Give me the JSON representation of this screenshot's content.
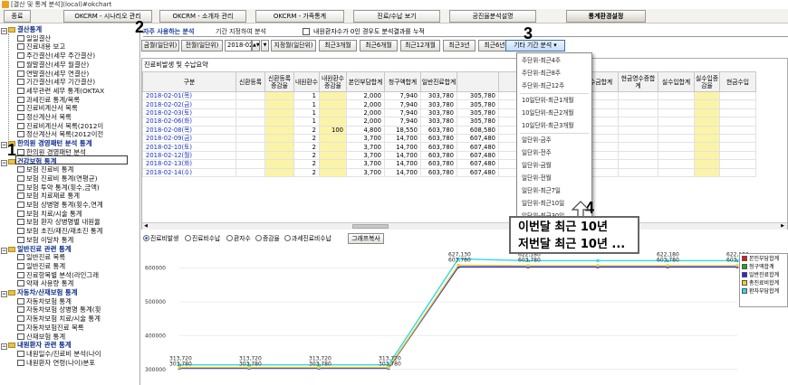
{
  "window_title": "[결산 및 통계 분석](local)#okchart",
  "top_menu": {
    "items": [
      "종료",
      "OKCRM - 시나리오 관리",
      "OKCRM - 소개자 관리",
      "OKCRM - 가족통계",
      "진료/수납 보기",
      "공진율분석설명",
      "통계환경설정"
    ],
    "active_index": 6
  },
  "tree": {
    "nodes": [
      {
        "label": "결산통계",
        "type": "cat"
      },
      {
        "label": "일일결산",
        "type": "leaf"
      },
      {
        "label": "진료내용 보고",
        "type": "leaf"
      },
      {
        "label": "주간결산(세무 주간결산)",
        "type": "leaf"
      },
      {
        "label": "월말결산(세무 월결산)",
        "type": "leaf"
      },
      {
        "label": "연말결산(세무 연결산)",
        "type": "leaf"
      },
      {
        "label": "기간결산(세무 기간결산)",
        "type": "leaf"
      },
      {
        "label": "세무관련 세무 통계(OKTAX",
        "type": "leaf"
      },
      {
        "label": "과세진료 통계/목록",
        "type": "leaf"
      },
      {
        "label": "진료비계산서 목록",
        "type": "leaf"
      },
      {
        "label": "정산계산서 목록",
        "type": "leaf"
      },
      {
        "label": "진료비계산서 목록(2012이",
        "type": "leaf"
      },
      {
        "label": "정산계산서 목록(2012이전",
        "type": "leaf"
      },
      {
        "label": "한의원 경영패턴 분석 통계",
        "type": "cat"
      },
      {
        "label": "한의원 경영패턴 분석",
        "type": "leaf"
      },
      {
        "label": "건강보험 통계",
        "type": "cat"
      },
      {
        "label": "보험 진료비 통계",
        "type": "leaf"
      },
      {
        "label": "보험 진료비 통계(연평균)",
        "type": "leaf"
      },
      {
        "label": "보험 투약 통계(횟수,금액)",
        "type": "leaf"
      },
      {
        "label": "보험 치료재료 통계",
        "type": "leaf"
      },
      {
        "label": "보험 상병명 통계(횟수,연계",
        "type": "leaf"
      },
      {
        "label": "보험 치료/시술 통계",
        "type": "leaf"
      },
      {
        "label": "보험 환자 상병명별 내원율",
        "type": "leaf"
      },
      {
        "label": "보험 초진/재진/재초진 통계",
        "type": "leaf"
      },
      {
        "label": "보험 이달차 통계",
        "type": "leaf"
      },
      {
        "label": "일반진료 관련 통계",
        "type": "cat"
      },
      {
        "label": "일반진료 목록",
        "type": "leaf"
      },
      {
        "label": "일반진료 통계",
        "type": "leaf"
      },
      {
        "label": "진료항목별 분석(라인그래",
        "type": "leaf"
      },
      {
        "label": "약재 사용량 통계",
        "type": "leaf"
      },
      {
        "label": "자동차/산재보험 통계",
        "type": "cat"
      },
      {
        "label": "자동차보험 통계",
        "type": "leaf"
      },
      {
        "label": "자동차보험 상병명 통계(횟",
        "type": "leaf"
      },
      {
        "label": "자동차보험 치료/시술 통계",
        "type": "leaf"
      },
      {
        "label": "자동차보험진료 목록",
        "type": "leaf"
      },
      {
        "label": "산재보험 통계",
        "type": "leaf"
      },
      {
        "label": "내원환자 관련 통계",
        "type": "cat"
      },
      {
        "label": "내원일수/진료비 분석(나이",
        "type": "leaf"
      },
      {
        "label": "내원환자 연령(나이)분포",
        "type": "leaf"
      }
    ]
  },
  "tabs": [
    "자주 사용하는 분석",
    "기간 지정하여 분석"
  ],
  "filter": {
    "buttons": [
      "금월(일단위)",
      "전월(일단위)",
      "2018-02",
      "지정월(일단위)",
      "최근3개월",
      "최근6개월",
      "최근12개월",
      "최근3년",
      "최근6년",
      "기타 기간 분석"
    ],
    "checkbox_label": "내원환자수가 0인 경우도 분석결과를 누적"
  },
  "grid": {
    "title": "진료비발생 및 수납요약",
    "columns": [
      "구분",
      "신환등록",
      "신환등록증감율",
      "내원환수",
      "내원환수증감율",
      "본인부담합계",
      "청구액합계",
      "일반진료합계",
      "",
      "",
      "",
      "미수금합계",
      "현금영수증합계",
      "실수입합계",
      "실수입증감율",
      "현금수입"
    ],
    "rows": [
      [
        "2018-02-01(목)",
        "",
        "",
        "1",
        "",
        "2,000",
        "7,940",
        "303,780",
        "305,780"
      ],
      [
        "2018-02-02(금)",
        "",
        "",
        "1",
        "",
        "2,000",
        "7,940",
        "303,780",
        "305,780"
      ],
      [
        "2018-02-03(토)",
        "",
        "",
        "1",
        "",
        "2,000",
        "7,940",
        "303,780",
        "305,780"
      ],
      [
        "2018-02-06(화)",
        "",
        "",
        "1",
        "",
        "2,000",
        "7,940",
        "303,780",
        "305,780"
      ],
      [
        "2018-02-08(목)",
        "",
        "",
        "2",
        "100",
        "4,800",
        "18,550",
        "603,780",
        "608,580"
      ],
      [
        "2018-02-09(금)",
        "",
        "",
        "2",
        "",
        "3,700",
        "14,700",
        "603,780",
        "607,480"
      ],
      [
        "2018-02-10(토)",
        "",
        "",
        "2",
        "",
        "3,700",
        "14,700",
        "603,780",
        "607,480"
      ],
      [
        "2018-02-12(월)",
        "",
        "",
        "2",
        "",
        "3,700",
        "14,700",
        "603,780",
        "607,480"
      ],
      [
        "2018-02-13(화)",
        "",
        "",
        "2",
        "",
        "3,700",
        "14,700",
        "603,780",
        "607,480"
      ],
      [
        "2018-02-14(수)",
        "",
        "",
        "2",
        "",
        "3,700",
        "14,700",
        "603,780",
        "607,480"
      ]
    ]
  },
  "dropdown": {
    "items": [
      "주단위-최근4주",
      "주단위-최근8주",
      "주단위-최근12주",
      "10일단위-최근1개월",
      "10일단위-최근2개월",
      "10일단위-최근3개월",
      "일단위-금주",
      "일단위-전주",
      "일단위-금월",
      "일단위-전월",
      "일단위-최근7일",
      "일단위-최근10일",
      "일단위-최근30일"
    ]
  },
  "radio_bar": {
    "options": [
      "진료비발생",
      "진료비수납",
      "환자수",
      "증감율",
      "과세진료비수납"
    ],
    "selected_index": 0,
    "copy_button": "그래프복사"
  },
  "chart_data": {
    "type": "line",
    "yticks": [
      "600000",
      "500000",
      "400000",
      "300000"
    ],
    "ylim": [
      270000,
      650000
    ],
    "series": [
      {
        "name": "본인부담합계",
        "color": "#e8141c"
      },
      {
        "name": "청구액합계",
        "color": "#1fa81f"
      },
      {
        "name": "일반진료합계",
        "color": "#2828e0"
      },
      {
        "name": "총진료비합계",
        "color": "#f0d020"
      },
      {
        "name": "환자부담합계",
        "color": "#30d8e8"
      }
    ],
    "lines": [
      {
        "color": "#2828e0",
        "points": [
          [
            0,
            303780
          ],
          [
            1,
            303780
          ],
          [
            2,
            303780
          ],
          [
            3,
            303780
          ],
          [
            4,
            603780
          ],
          [
            5,
            603780
          ],
          [
            6,
            603780
          ],
          [
            7,
            603780
          ],
          [
            8,
            603780
          ]
        ]
      },
      {
        "color": "#f0d020",
        "points": [
          [
            0,
            305780
          ],
          [
            1,
            305780
          ],
          [
            2,
            305780
          ],
          [
            3,
            305780
          ],
          [
            4,
            608580
          ],
          [
            5,
            607480
          ],
          [
            6,
            607480
          ],
          [
            7,
            607480
          ],
          [
            8,
            607480
          ]
        ]
      },
      {
        "color": "#30d8e8",
        "points": [
          [
            0,
            313720
          ],
          [
            1,
            313720
          ],
          [
            2,
            313720
          ],
          [
            3,
            313720
          ],
          [
            4,
            627130
          ],
          [
            5,
            622180
          ],
          [
            6,
            622180
          ],
          [
            7,
            622180
          ],
          [
            8,
            622180
          ]
        ]
      }
    ],
    "data_labels": [
      {
        "i": 0,
        "top": "313,720",
        "bot": "303,780"
      },
      {
        "i": 1,
        "top": "313,720",
        "bot": "303,780"
      },
      {
        "i": 2,
        "top": "313,720",
        "bot": "303,780"
      },
      {
        "i": 3,
        "top": "313,720",
        "bot": "303,780"
      },
      {
        "i": 4,
        "top": "627,130",
        "bot": "603,780"
      },
      {
        "i": 5,
        "top": "622,180",
        "bot": "603,780"
      },
      {
        "i": 6,
        "top": "622,180",
        "bot": "603,780"
      },
      {
        "i": 7,
        "top": "622,180",
        "bot": "603,780"
      },
      {
        "i": 8,
        "top": "622,180",
        "bot": "603,780"
      }
    ]
  },
  "annotations": {
    "n1": "1",
    "n2": "2",
    "n3": "3",
    "n4": "4",
    "callout_line1": "이번달 최근 10년",
    "callout_line2": "저번달 최근 10년 ..."
  }
}
